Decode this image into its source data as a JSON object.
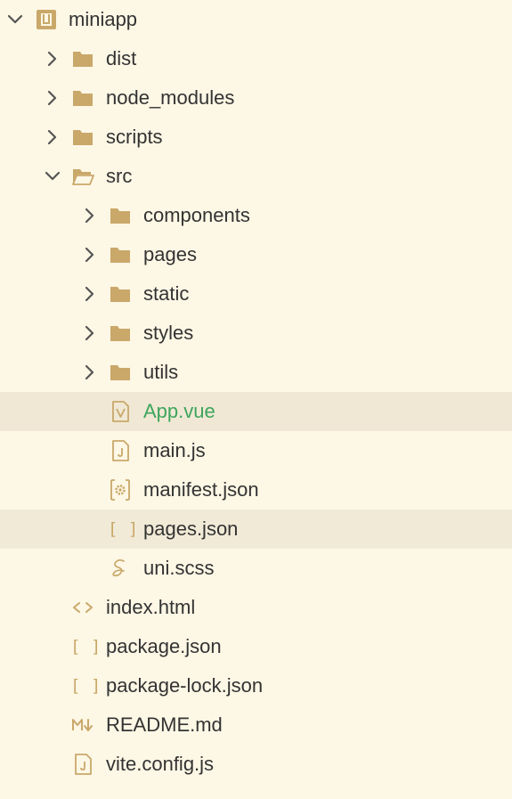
{
  "colors": {
    "background": "#fdf7e5",
    "selected_row": "#f0e8d4",
    "folder_icon": "#c9a86a",
    "text": "#333333",
    "active_file_text": "#3da55d"
  },
  "tree": {
    "root": {
      "label": "miniapp",
      "expanded": true,
      "icon": "project-icon"
    },
    "dist": {
      "label": "dist",
      "expanded": false,
      "icon": "folder-icon"
    },
    "node_modules": {
      "label": "node_modules",
      "expanded": false,
      "icon": "folder-icon"
    },
    "scripts": {
      "label": "scripts",
      "expanded": false,
      "icon": "folder-icon"
    },
    "src": {
      "label": "src",
      "expanded": true,
      "icon": "folder-open-icon"
    },
    "components": {
      "label": "components",
      "expanded": false,
      "icon": "folder-icon"
    },
    "pages": {
      "label": "pages",
      "expanded": false,
      "icon": "folder-icon"
    },
    "static": {
      "label": "static",
      "expanded": false,
      "icon": "folder-icon"
    },
    "styles": {
      "label": "styles",
      "expanded": false,
      "icon": "folder-icon"
    },
    "utils": {
      "label": "utils",
      "expanded": false,
      "icon": "folder-icon"
    },
    "app_vue": {
      "label": "App.vue",
      "icon": "vue-file-icon",
      "active": true
    },
    "main_js": {
      "label": "main.js",
      "icon": "js-file-icon"
    },
    "manifest_json": {
      "label": "manifest.json",
      "icon": "settings-file-icon"
    },
    "pages_json": {
      "label": "pages.json",
      "icon": "json-file-icon",
      "hovered": true
    },
    "uni_scss": {
      "label": "uni.scss",
      "icon": "sass-file-icon"
    },
    "index_html": {
      "label": "index.html",
      "icon": "html-file-icon"
    },
    "package_json": {
      "label": "package.json",
      "icon": "json-file-icon"
    },
    "package_lock_json": {
      "label": "package-lock.json",
      "icon": "json-file-icon"
    },
    "readme_md": {
      "label": "README.md",
      "icon": "markdown-file-icon"
    },
    "vite_config_js": {
      "label": "vite.config.js",
      "icon": "js-file-icon"
    }
  },
  "glyphs": {
    "json": "[ ]",
    "html": "<>"
  }
}
